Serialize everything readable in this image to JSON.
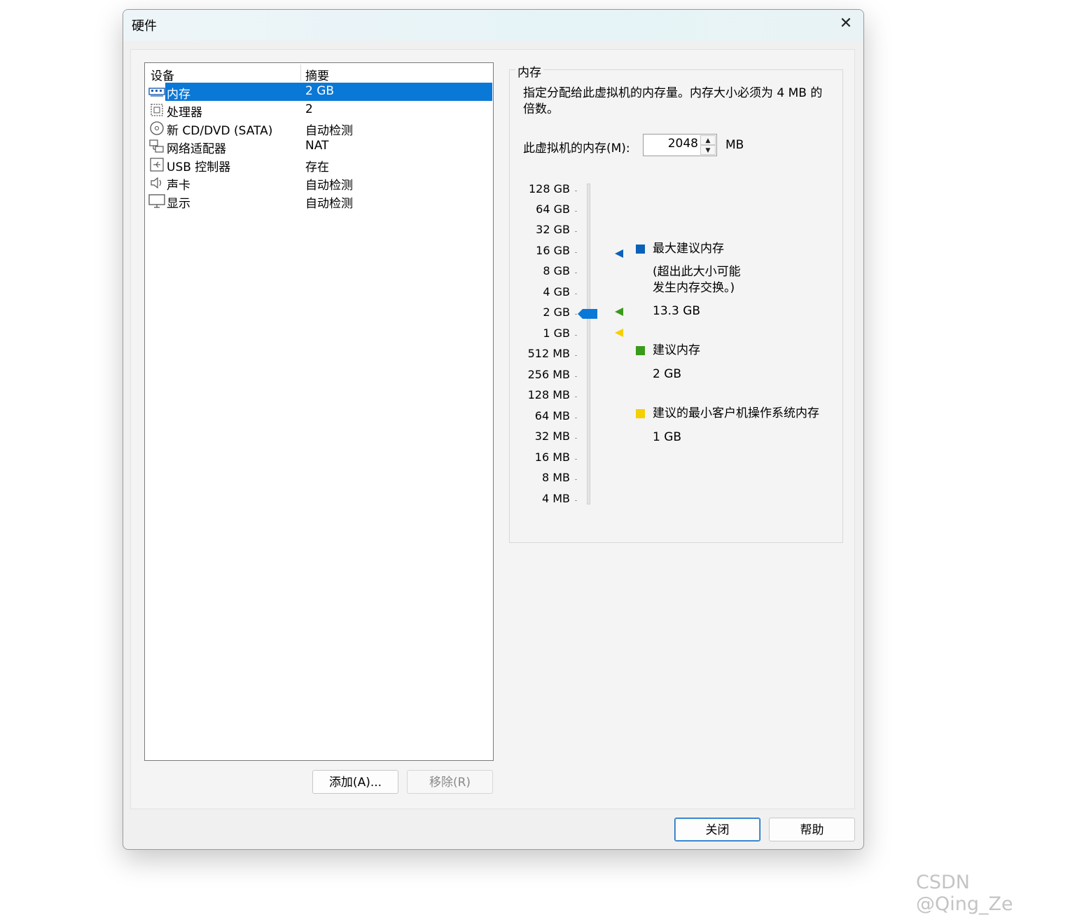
{
  "window": {
    "title": "硬件",
    "close_glyph": "✕"
  },
  "device_list": {
    "headers": {
      "device": "设备",
      "summary": "摘要"
    },
    "rows": [
      {
        "icon": "memory-icon",
        "name": "内存",
        "summary": "2 GB",
        "selected": true
      },
      {
        "icon": "processor-icon",
        "name": "处理器",
        "summary": "2"
      },
      {
        "icon": "cd-dvd-icon",
        "name": "新 CD/DVD (SATA)",
        "summary": "自动检测"
      },
      {
        "icon": "network-adapter-icon",
        "name": "网络适配器",
        "summary": "NAT"
      },
      {
        "icon": "usb-controller-icon",
        "name": "USB 控制器",
        "summary": "存在"
      },
      {
        "icon": "sound-card-icon",
        "name": "声卡",
        "summary": "自动检测"
      },
      {
        "icon": "display-icon",
        "name": "显示",
        "summary": "自动检测"
      }
    ]
  },
  "buttons": {
    "add": "添加(A)...",
    "remove": "移除(R)",
    "close": "关闭",
    "help": "帮助"
  },
  "memory_panel": {
    "group_title": "内存",
    "description": "指定分配给此虚拟机的内存量。内存大小必须为 4 MB 的倍数。",
    "input_label": "此虚拟机的内存(M):",
    "input_value": "2048",
    "unit": "MB",
    "scale_labels": [
      "128 GB",
      "64 GB",
      "32 GB",
      "16 GB",
      "8 GB",
      "4 GB",
      "2 GB",
      "1 GB",
      "512 MB",
      "256 MB",
      "128 MB",
      "64 MB",
      "32 MB",
      "16 MB",
      "8 MB",
      "4 MB"
    ],
    "slider_value": "2 GB",
    "legend": {
      "max": {
        "title": "最大建议内存",
        "note_line1": "(超出此大小可能",
        "note_line2": "发生内存交换。)",
        "value": "13.3 GB",
        "color": "#0a62b8"
      },
      "recommended": {
        "title": "建议内存",
        "value": "2 GB",
        "color": "#3a9a1a"
      },
      "min": {
        "title": "建议的最小客户机操作系统内存",
        "value": "1 GB",
        "color": "#f5d000"
      }
    },
    "slider_color": "#0a78d7"
  },
  "watermark": "CSDN @Qing_Ze"
}
